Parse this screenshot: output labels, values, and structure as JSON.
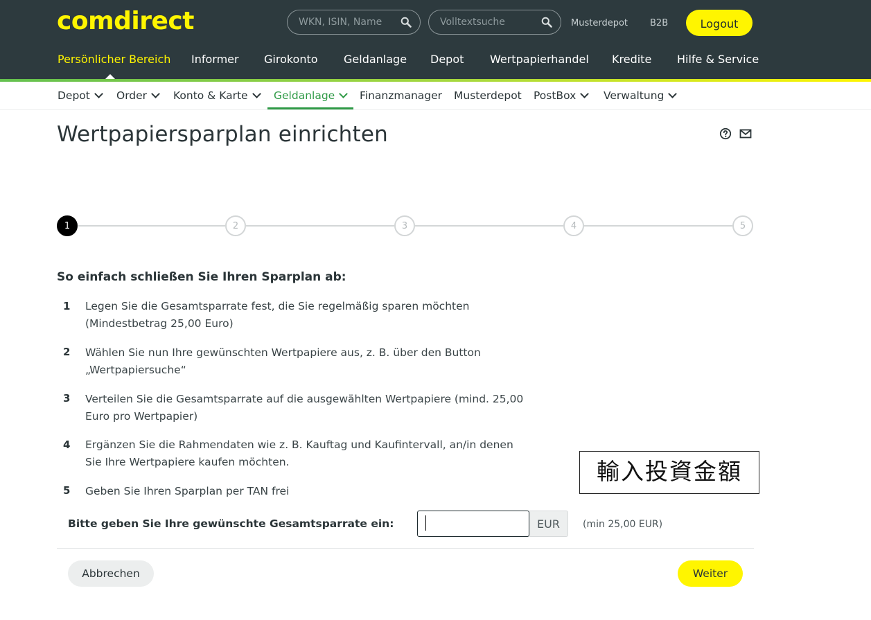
{
  "header": {
    "logo": "comdirect",
    "search_wkn": {
      "placeholder": "WKN, ISIN, Name",
      "icon": "search-icon"
    },
    "search_fulltext": {
      "placeholder": "Volltextsuche",
      "icon": "search-icon"
    },
    "links": [
      "Musterdepot",
      "B2B"
    ],
    "logout_label": "Logout"
  },
  "main_nav": {
    "items": [
      "Persönlicher Bereich",
      "Informer",
      "Girokonto",
      "Geldanlage",
      "Depot",
      "Wertpapierhandel",
      "Kredite",
      "Hilfe & Service"
    ],
    "active": "Persönlicher Bereich"
  },
  "sub_nav": {
    "items": [
      "Depot",
      "Order",
      "Konto & Karte",
      "Geldanlage",
      "Finanzmanager",
      "Musterdepot",
      "PostBox",
      "Verwaltung"
    ],
    "active": "Geldanlage"
  },
  "page": {
    "title": "Wertpapiersparplan einrichten",
    "icons": [
      "help-icon",
      "mail-icon"
    ]
  },
  "stepper": {
    "steps": [
      "1",
      "2",
      "3",
      "4",
      "5"
    ],
    "current": 1
  },
  "instructions": {
    "heading": "So einfach schließen Sie Ihren Sparplan ab:",
    "items": [
      {
        "num": "1",
        "text": "Legen Sie die Gesamtsparrate fest, die Sie regelmäßig sparen möchten (Mindestbetrag 25,00 Euro)"
      },
      {
        "num": "2",
        "text": "Wählen Sie nun Ihre gewünschten Wertpapiere aus, z. B. über den Button „Wertpapiersuche“"
      },
      {
        "num": "3",
        "text": "Verteilen Sie die Gesamtsparrate auf die ausgewählten Wertpapiere (mind. 25,00 Euro pro Wertpapier)"
      },
      {
        "num": "4",
        "text": "Ergänzen Sie die Rahmendaten wie z. B. Kauftag und Kaufintervall, an/in denen Sie Ihre Wertpapiere kaufen möchten."
      },
      {
        "num": "5",
        "text": "Geben Sie Ihren Sparplan per TAN frei"
      }
    ]
  },
  "annotation": "輸入投資金額",
  "amount": {
    "label": "Bitte geben Sie Ihre gewünschte Gesamtsparrate ein:",
    "value": "",
    "currency": "EUR",
    "hint": "(min 25,00 EUR)"
  },
  "actions": {
    "cancel": "Abbrechen",
    "next": "Weiter"
  },
  "colors": {
    "header_bg": "#2d3a3e",
    "brand_yellow": "#fff500",
    "active_green": "#2f9a46"
  }
}
